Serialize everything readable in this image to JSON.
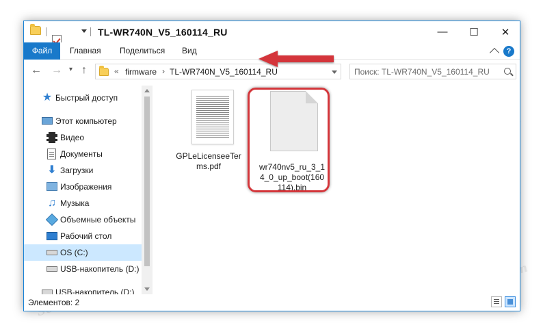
{
  "window": {
    "title": "TL-WR740N_V5_160114_RU",
    "controls": {
      "minimize": "—",
      "maximize": "☐",
      "close": "✕"
    }
  },
  "ribbon": {
    "tabs": [
      {
        "label": "Файл"
      },
      {
        "label": "Главная"
      },
      {
        "label": "Поделиться"
      },
      {
        "label": "Вид"
      }
    ]
  },
  "address": {
    "overflow": "«",
    "crumbs": [
      "firmware",
      "TL-WR740N_V5_160114_RU"
    ],
    "separator": "›"
  },
  "search": {
    "placeholder": "Поиск: TL-WR740N_V5_160114_RU"
  },
  "sidebar": {
    "items": [
      {
        "label": "Быстрый доступ",
        "icon": "star-icon"
      },
      {
        "label": "Этот компьютер",
        "icon": "computer-icon"
      },
      {
        "label": "Видео",
        "icon": "video-icon"
      },
      {
        "label": "Документы",
        "icon": "documents-icon"
      },
      {
        "label": "Загрузки",
        "icon": "downloads-icon"
      },
      {
        "label": "Изображения",
        "icon": "pictures-icon"
      },
      {
        "label": "Музыка",
        "icon": "music-icon"
      },
      {
        "label": "Объемные объекты",
        "icon": "3d-objects-icon"
      },
      {
        "label": "Рабочий стол",
        "icon": "desktop-icon"
      },
      {
        "label": "OS (C:)",
        "icon": "drive-icon",
        "selected": true
      },
      {
        "label": "USB-накопитель (D:)",
        "icon": "usb-drive-icon"
      },
      {
        "label": "USB-накопитель (D:)",
        "icon": "usb-drive-icon"
      }
    ]
  },
  "files": [
    {
      "name": "GPLeLicenseeTerms.pdf",
      "line1": "GPLeLicenseeTer",
      "line2": "ms.pdf",
      "type": "pdf"
    },
    {
      "name": "wr740nv5_ru_3_14_0_up_boot(160114).bin",
      "line1": "wr740nv5_ru_3_1",
      "line2": "4_0_up_boot(160",
      "line3": "114).bin",
      "type": "bin"
    }
  ],
  "status": {
    "count_text": "Элементов: 2"
  },
  "watermark": "Soringpcrepair.com",
  "colors": {
    "accent": "#1979ca",
    "selection": "#cce8ff",
    "annotation": "#d4363b"
  }
}
